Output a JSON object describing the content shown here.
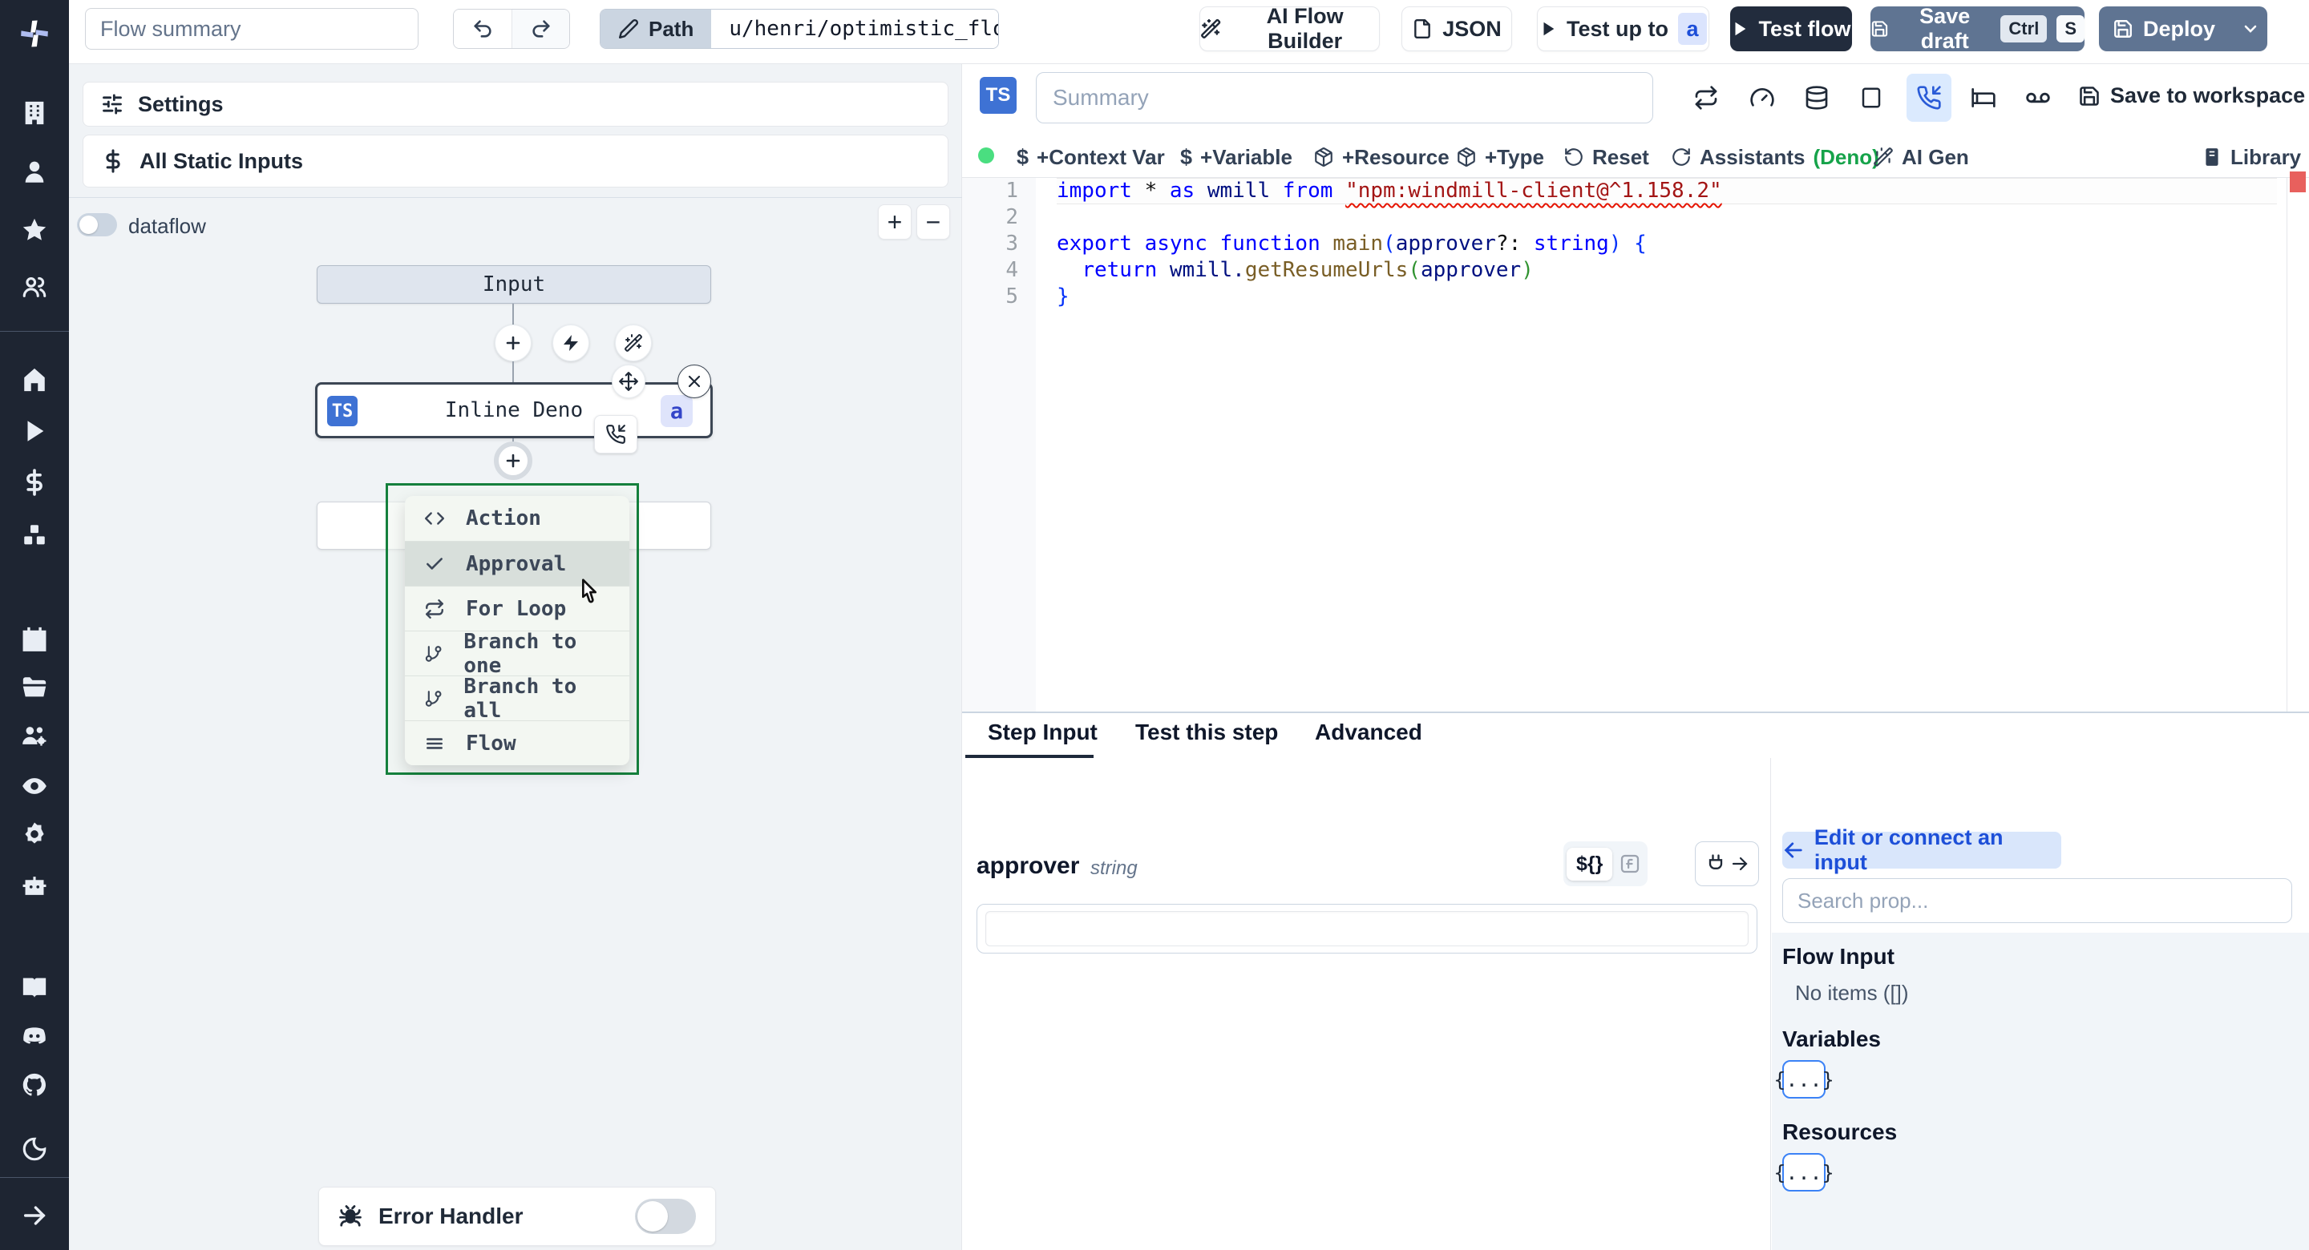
{
  "colors": {
    "accent": "#3e72d4",
    "slate_button": "#5f7492",
    "dark_button": "#222c3d",
    "deno_green": "#16a34a",
    "menu_border": "#15803d",
    "error_marker": "#e8605d",
    "online_dot": "#4ade80"
  },
  "topbar": {
    "flow_summary_placeholder": "Flow summary",
    "path_label": "Path",
    "path_value": "u/henri/optimistic_flow",
    "ai_flow_builder": "AI Flow Builder",
    "json_button": "JSON",
    "test_up_to": "Test up to",
    "test_up_to_badge": "a",
    "test_flow": "Test flow",
    "save_draft": "Save draft",
    "save_draft_kbd": [
      "Ctrl",
      "S"
    ],
    "deploy": "Deploy"
  },
  "sidebar": {
    "icons": [
      "windmill-logo",
      "building",
      "user",
      "star",
      "users",
      "home",
      "play",
      "dollar",
      "boxes",
      "calendar",
      "folder",
      "users-cog",
      "eye",
      "gear",
      "robot",
      "book",
      "discord",
      "github",
      "moon",
      "arrow-right"
    ]
  },
  "left_panel": {
    "settings_label": "Settings",
    "static_inputs_label": "All Static Inputs",
    "dataflow_label": "dataflow",
    "zoom_in": "+",
    "zoom_out": "−",
    "input_node_label": "Input",
    "step_node": {
      "lang_badge": "TS",
      "label": "Inline Deno",
      "suffix_badge": "a"
    },
    "menu": {
      "items": [
        {
          "icon": "code-icon",
          "label": "Action"
        },
        {
          "icon": "check-icon",
          "label": "Approval"
        },
        {
          "icon": "repeat-icon",
          "label": "For Loop"
        },
        {
          "icon": "git-branch-icon",
          "label": "Branch to one"
        },
        {
          "icon": "git-branch-icon",
          "label": "Branch to all"
        },
        {
          "icon": "lines-icon",
          "label": "Flow"
        }
      ]
    },
    "error_handler_label": "Error Handler"
  },
  "editor": {
    "lang_badge": "TS",
    "summary_placeholder": "Summary",
    "toolbar_icons": [
      "retries",
      "gauge",
      "cache",
      "stop",
      "phone-incoming",
      "sleep",
      "mock",
      "save"
    ],
    "save_to_workspace": "Save to workspace",
    "actions": {
      "context_var": "+Context Var",
      "variable": "+Variable",
      "resource": "+Resource",
      "type": "+Type",
      "reset": "Reset",
      "assistants": "Assistants",
      "assistants_lang": "(Deno)",
      "ai_gen": "AI Gen",
      "library": "Library"
    },
    "code": {
      "line_numbers": [
        "1",
        "2",
        "3",
        "4",
        "5"
      ],
      "lines": [
        {
          "current": true,
          "tokens": [
            {
              "t": "import",
              "c": "kw"
            },
            {
              "t": " * ",
              "c": "pl"
            },
            {
              "t": "as",
              "c": "kw"
            },
            {
              "t": " wmill ",
              "c": "id"
            },
            {
              "t": "from",
              "c": "kw"
            },
            {
              "t": " ",
              "c": "pl"
            },
            {
              "t": "\"npm:windmill-client@^1.158.2\"",
              "c": "str",
              "squiggle": true
            }
          ]
        },
        {
          "tokens": []
        },
        {
          "tokens": [
            {
              "t": "export",
              "c": "kw"
            },
            {
              "t": " ",
              "c": "pl"
            },
            {
              "t": "async",
              "c": "kw"
            },
            {
              "t": " ",
              "c": "pl"
            },
            {
              "t": "function",
              "c": "kw"
            },
            {
              "t": " ",
              "c": "pl"
            },
            {
              "t": "main",
              "c": "fn"
            },
            {
              "t": "(",
              "c": "b1"
            },
            {
              "t": "approver",
              "c": "id"
            },
            {
              "t": "?: ",
              "c": "pl"
            },
            {
              "t": "string",
              "c": "kw"
            },
            {
              "t": ")",
              "c": "b1"
            },
            {
              "t": " {",
              "c": "b1"
            }
          ]
        },
        {
          "tokens": [
            {
              "t": "  ",
              "c": "pl"
            },
            {
              "t": "return",
              "c": "kw"
            },
            {
              "t": " wmill.",
              "c": "id"
            },
            {
              "t": "getResumeUrls",
              "c": "fn"
            },
            {
              "t": "(",
              "c": "b2"
            },
            {
              "t": "approver",
              "c": "id"
            },
            {
              "t": ")",
              "c": "b2"
            }
          ]
        },
        {
          "tokens": [
            {
              "t": "}",
              "c": "b1"
            }
          ]
        }
      ]
    }
  },
  "bottom": {
    "tabs": [
      "Step Input",
      "Test this step",
      "Advanced"
    ],
    "field": {
      "name": "approver",
      "type": "string"
    },
    "expr_toggle": "${}",
    "fn_toggle": "f",
    "connect": {
      "back_button": "Edit or connect an input",
      "search_placeholder": "Search prop...",
      "flow_input_heading": "Flow Input",
      "no_items": "No items ([])",
      "variables_heading": "Variables",
      "resources_heading": "Resources",
      "object_chip": "{...}"
    }
  }
}
